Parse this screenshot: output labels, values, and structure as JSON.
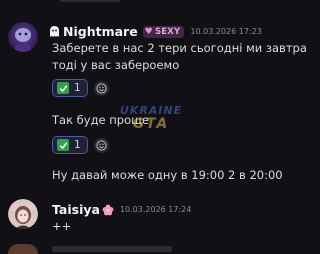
{
  "messages": [
    {
      "author": "Nightmare",
      "author_prefix_icon": "ghost-icon",
      "role": "SEXY",
      "role_icon": "heart-icon",
      "timestamp": "10.03.2026 17:23",
      "lines": [
        "Заберете в  нас 2 тери сьогодні ми завтра",
        "тоді у вас забероемо"
      ],
      "reaction": {
        "emoji": "check-mark-icon",
        "count": "1"
      }
    },
    {
      "lines": [
        "Так буде проще"
      ],
      "reaction": {
        "emoji": "check-mark-icon",
        "count": "1"
      }
    },
    {
      "lines": [
        "Ну давай може одну в 19:00 2 в 20:00"
      ]
    },
    {
      "author": "Taisiya",
      "author_suffix_icon": "flower-icon",
      "timestamp": "10.03.2026 17:24",
      "lines": [
        "++"
      ]
    }
  ],
  "watermark": {
    "line1": "UKRAINE",
    "line2": "GTA"
  },
  "colors": {
    "background": "#101015",
    "reaction_border": "#4d5a9f",
    "check_green": "#2fa24a",
    "role_pink": "#e9a3d9"
  }
}
